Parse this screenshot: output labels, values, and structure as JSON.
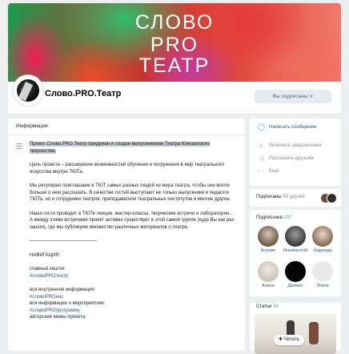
{
  "cover": {
    "line1": "СЛОВО",
    "line2": "PRO",
    "line3": "ТЕАТР"
  },
  "header": {
    "group_name": "Слово.PRO.Театр",
    "subscribe_button": "Вы подписаны ∨"
  },
  "info": {
    "heading": "Информация",
    "paragraphs": {
      "p1": "Проект Слово.PRO.Театр придуман и создан выпускниками Театра Юношеского творчества.",
      "p2": "Цель проекта – расширение возможностей обучения и погружения в мир театрального искусства внутри ТЮТа.",
      "p3": "Мы регулярно приглашаем в ТЮТ самых разных людей из мира театра, чтобы они могли больше о нем рассказать. В качестве гостей выступают не только выпускники и педагоги ТЮТа, но и сотрудники театров, преподаватели театральных институтов и многие другие.",
      "p4": "Наши гости проводят в ТЮТе лекции, мастер-классы, творческие встречи и лаборатории... А между этими встречами проект активно существует в этой самой группе (куда Вы как раз зашли), где мы публикуем множество различных материалов о театре.",
      "divider": "——————————————",
      "nav_label": "НАВИГАЦИЯ:",
      "main_hashtag_label": "главный хештег:",
      "main_hashtag": "#словоPROтеатр",
      "internal_label": "вся внутренняя информация:",
      "internal_tag": "#словоPROнас",
      "events_label": "вся информация о мероприятиях:",
      "events_tag": "#словоPROпрограмму",
      "memes_label": "авторские мемы проекта:"
    }
  },
  "actions": {
    "message": "Написать сообщение",
    "notifications": "Включить уведомления",
    "recommend": "Рассказать друзьям",
    "more": "Ещё"
  },
  "friends": {
    "label": "Подписаны",
    "count": "59 друзей"
  },
  "subscribers": {
    "label": "Подписчики",
    "count": "297",
    "people": [
      {
        "name": "Ксения"
      },
      {
        "name": "Иннокентий"
      },
      {
        "name": "Надежда"
      },
      {
        "name": "Алиса"
      },
      {
        "name": "Даниил"
      },
      {
        "name": "Элизе"
      }
    ]
  },
  "articles": {
    "label": "Статьи",
    "count": "36",
    "read_button": "Читать"
  },
  "icons": [
    "lines-icon",
    "message-icon",
    "bell-icon",
    "megaphone-icon",
    "more-icon",
    "read-icon"
  ]
}
